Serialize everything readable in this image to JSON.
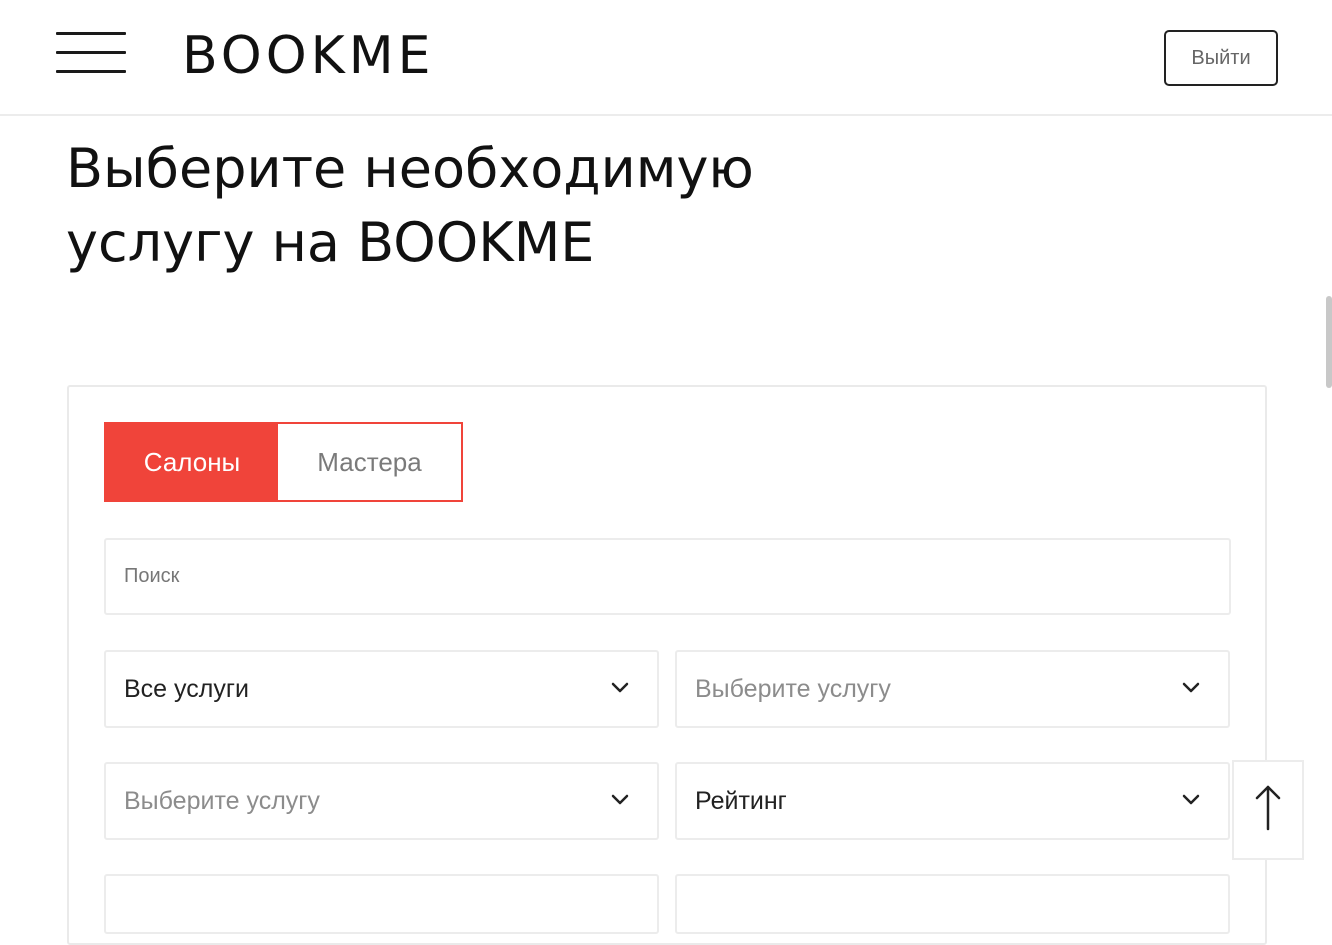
{
  "header": {
    "logo": "BOOKME",
    "logout_label": "Выйти",
    "menu_icon": "hamburger-menu-icon"
  },
  "page": {
    "title_line1": "Выберите необходимую",
    "title_line2": "услугу на BOOKME"
  },
  "search": {
    "tabs": [
      {
        "label": "Салоны",
        "active": true
      },
      {
        "label": "Мастера",
        "active": false
      }
    ],
    "placeholder": "Поиск",
    "filters": [
      {
        "value": "Все услуги",
        "is_placeholder": false
      },
      {
        "value": "Выберите услугу",
        "is_placeholder": true
      },
      {
        "value": "Выберите услугу",
        "is_placeholder": true
      },
      {
        "value": "Рейтинг",
        "is_placeholder": false
      }
    ]
  },
  "colors": {
    "accent": "#f0443a",
    "border": "#ececec"
  },
  "icons": {
    "dropdown": "chevron-down-icon",
    "scroll_top": "arrow-up-icon"
  }
}
